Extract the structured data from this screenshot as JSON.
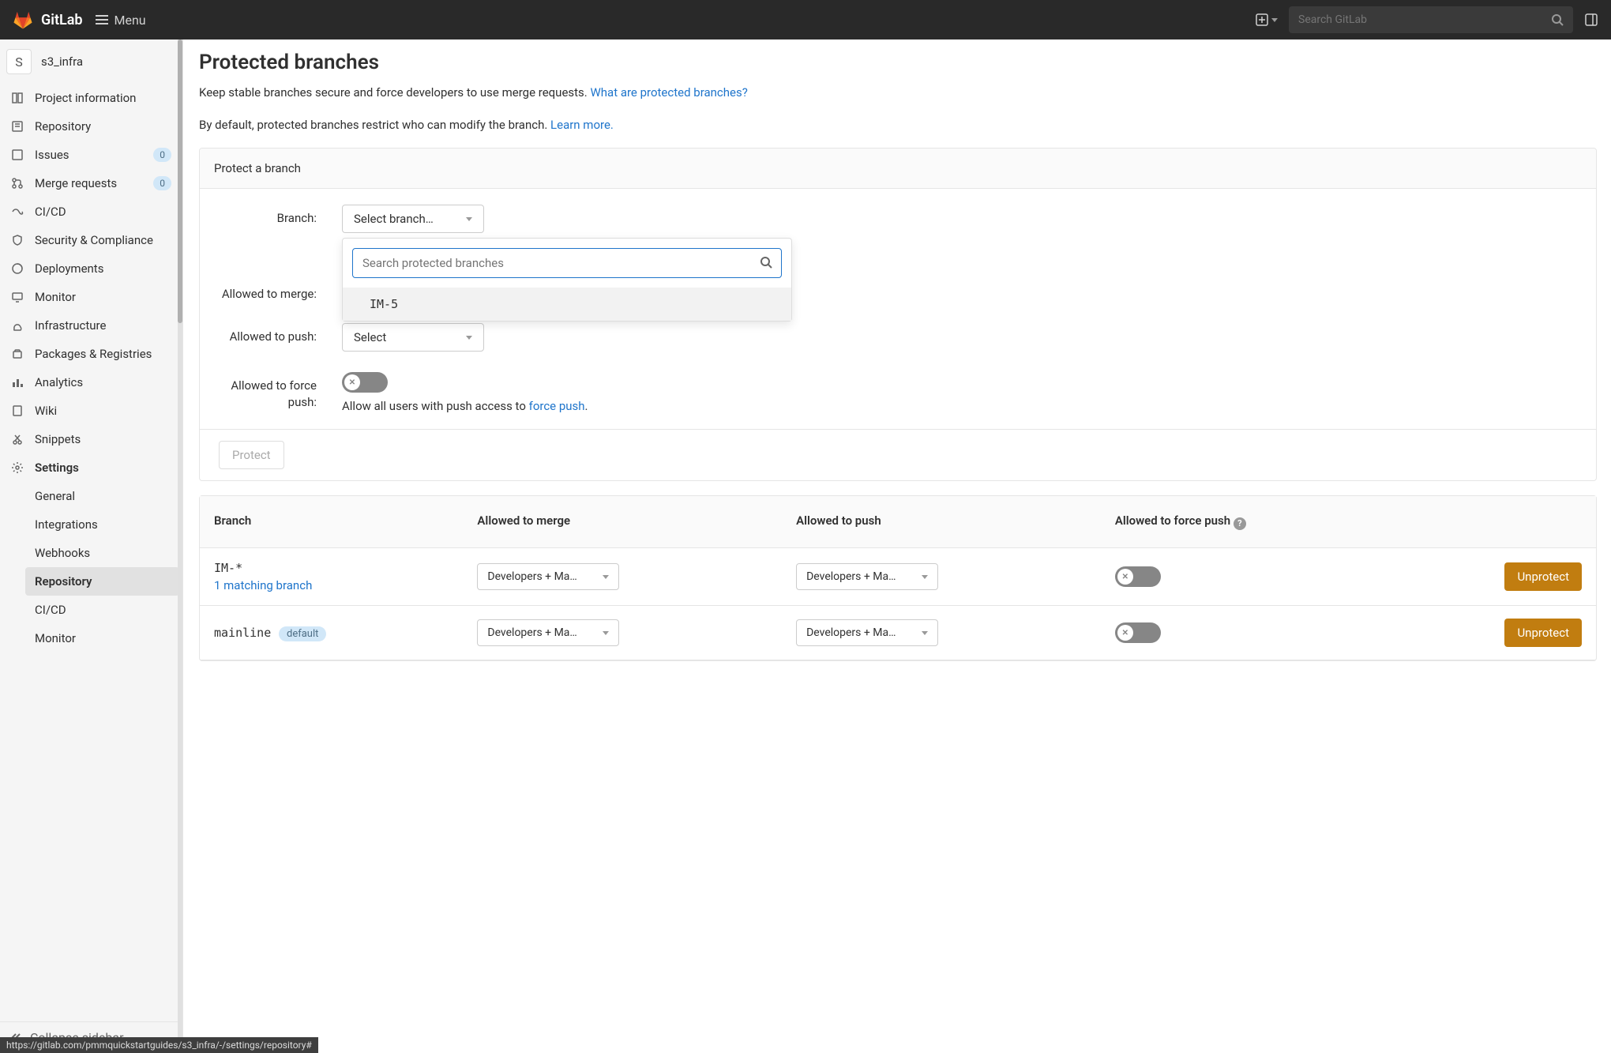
{
  "header": {
    "brand": "GitLab",
    "menu_label": "Menu",
    "search_placeholder": "Search GitLab"
  },
  "project": {
    "avatar_letter": "S",
    "name": "s3_infra"
  },
  "sidebar": {
    "items": [
      {
        "label": "Project information"
      },
      {
        "label": "Repository"
      },
      {
        "label": "Issues",
        "badge": "0"
      },
      {
        "label": "Merge requests",
        "badge": "0"
      },
      {
        "label": "CI/CD"
      },
      {
        "label": "Security & Compliance"
      },
      {
        "label": "Deployments"
      },
      {
        "label": "Monitor"
      },
      {
        "label": "Infrastructure"
      },
      {
        "label": "Packages & Registries"
      },
      {
        "label": "Analytics"
      },
      {
        "label": "Wiki"
      },
      {
        "label": "Snippets"
      },
      {
        "label": "Settings"
      }
    ],
    "settings_children": [
      {
        "label": "General"
      },
      {
        "label": "Integrations"
      },
      {
        "label": "Webhooks"
      },
      {
        "label": "Repository"
      },
      {
        "label": "CI/CD"
      },
      {
        "label": "Monitor"
      }
    ],
    "collapse_label": "Collapse sidebar"
  },
  "page": {
    "title": "Protected branches",
    "desc1": "Keep stable branches secure and force developers to use merge requests. ",
    "desc1_link": "What are protected branches?",
    "desc2": "By default, protected branches restrict who can modify the branch. ",
    "desc2_link": "Learn more."
  },
  "protect_panel": {
    "header": "Protect a branch",
    "branch_label": "Branch:",
    "branch_select_text": "Select branch…",
    "search_placeholder": "Search protected branches",
    "option1": "IM-5",
    "merge_label": "Allowed to merge:",
    "push_label": "Allowed to push:",
    "push_select_text": "Select",
    "force_label": "Allowed to force push:",
    "force_helper_pre": "Allow all users with push access to ",
    "force_helper_link": "force push",
    "force_helper_post": ".",
    "protect_button": "Protect"
  },
  "table": {
    "headers": {
      "branch": "Branch",
      "merge": "Allowed to merge",
      "push": "Allowed to push",
      "force": "Allowed to force push"
    },
    "rows": [
      {
        "name": "IM-*",
        "matching": "1 matching branch",
        "merge": "Developers + Ma…",
        "push": "Developers + Ma…",
        "action": "Unprotect"
      },
      {
        "name": "mainline",
        "default": "default",
        "merge": "Developers + Ma…",
        "push": "Developers + Ma…",
        "action": "Unprotect"
      }
    ]
  },
  "status_url": "https://gitlab.com/pmmquickstartguides/s3_infra/-/settings/repository#"
}
